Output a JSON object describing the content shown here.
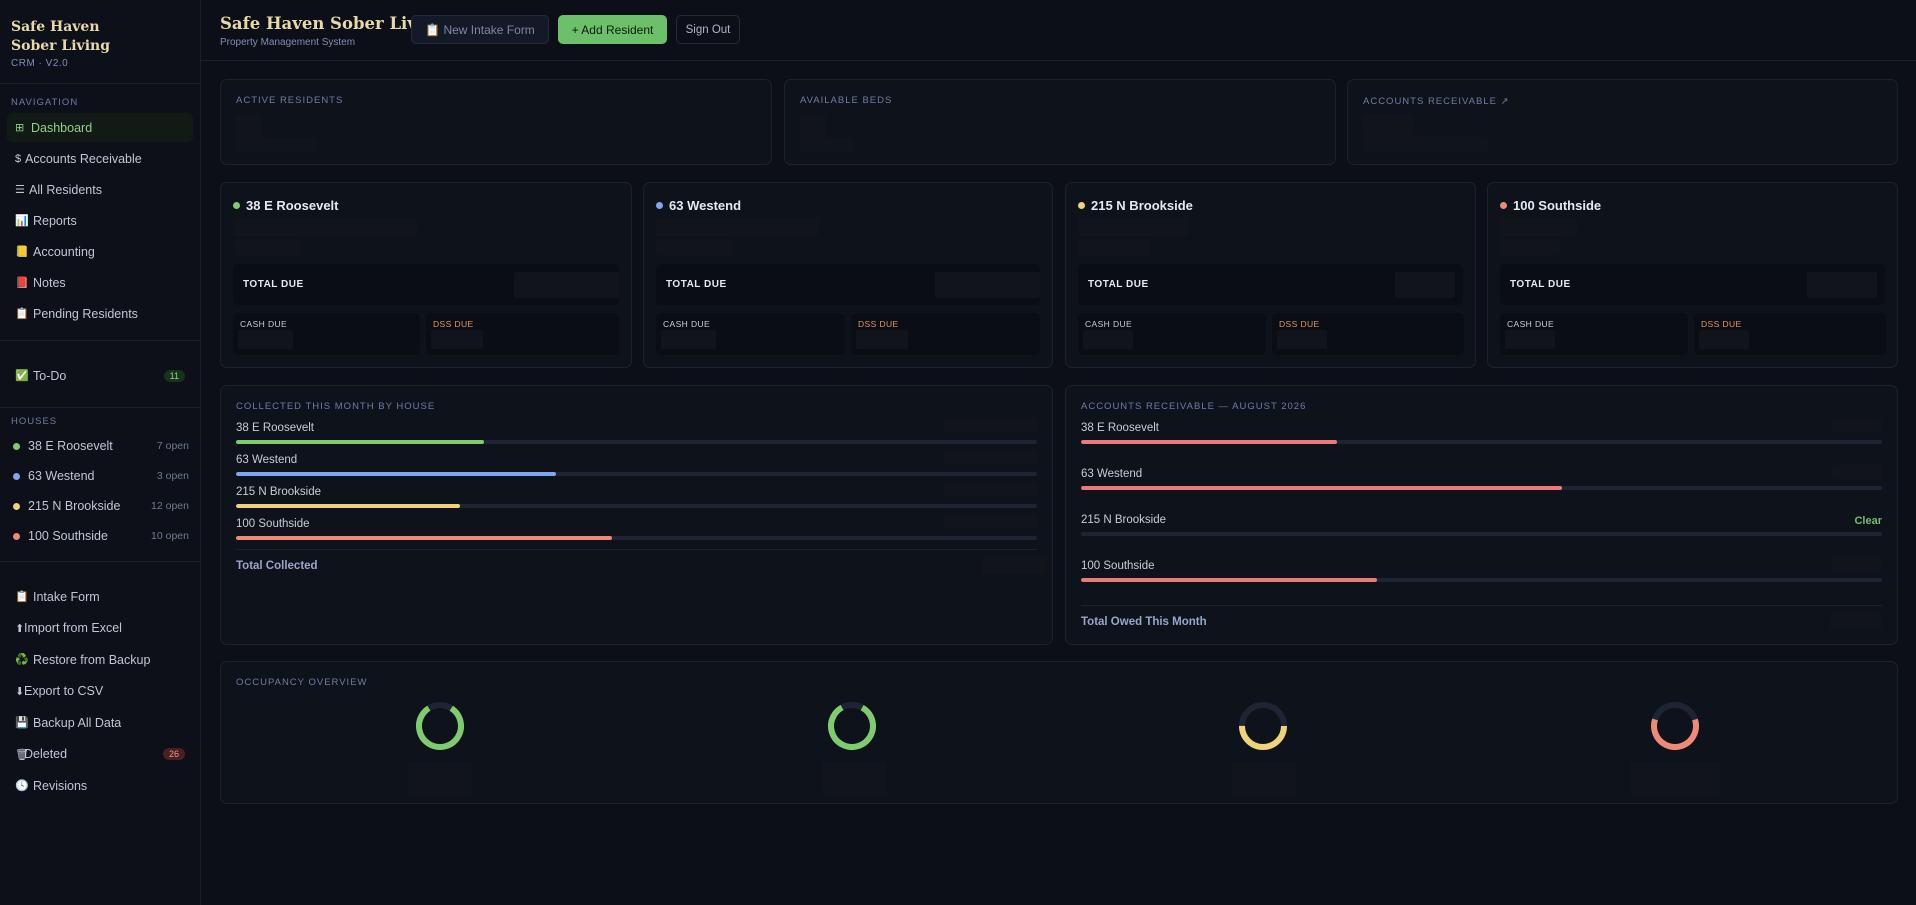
{
  "colors": {
    "green": "#7fcc6f",
    "blue": "#7fa6f0",
    "yellow": "#efd27a",
    "salmon": "#ee8a76",
    "red": "#ec7a7a",
    "accent": "#6cc069"
  },
  "brand": {
    "line1": "Safe Haven",
    "line2": "Sober Living",
    "version": "CRM · V2.0"
  },
  "sidebar": {
    "nav_label": "NAVIGATION",
    "nav": [
      {
        "icon": "⊞",
        "label": "Dashboard"
      },
      {
        "icon": "$",
        "label": "Accounts Receivable"
      },
      {
        "icon": "☰",
        "label": "All Residents"
      },
      {
        "icon": "📊",
        "label": "Reports"
      },
      {
        "icon": "📒",
        "label": "Accounting"
      },
      {
        "icon": "📕",
        "label": "Notes"
      },
      {
        "icon": "📋",
        "label": "Pending Residents"
      }
    ],
    "todo": {
      "icon": "✅",
      "label": "To-Do",
      "count": "11"
    },
    "houses_label": "HOUSES",
    "houses": [
      {
        "name": "38 E Roosevelt",
        "open": "7 open",
        "color": "#7fcc6f"
      },
      {
        "name": "63 Westend",
        "open": "3 open",
        "color": "#7fa6f0"
      },
      {
        "name": "215 N Brookside",
        "open": "12 open",
        "color": "#efd27a"
      },
      {
        "name": "100 Southside",
        "open": "10 open",
        "color": "#ee8a76"
      }
    ],
    "tools": [
      {
        "icon": "📋",
        "label": "Intake Form"
      },
      {
        "icon": "⬆",
        "label": "Import from Excel"
      },
      {
        "icon": "♻️",
        "label": "Restore from Backup"
      },
      {
        "icon": "⬇",
        "label": "Export to CSV"
      },
      {
        "icon": "💾",
        "label": "Backup All Data"
      },
      {
        "icon": "🗑",
        "label": "Deleted",
        "count": "26"
      },
      {
        "icon": "🕓",
        "label": "Revisions"
      }
    ]
  },
  "header": {
    "title": "Safe Haven Sober Living",
    "subtitle": "Property Management System",
    "intake_btn": "📋  New Intake Form",
    "add_btn": "+ Add Resident",
    "signout_btn": "Sign Out"
  },
  "stats": {
    "active_residents": "ACTIVE RESIDENTS",
    "available_beds": "AVAILABLE BEDS",
    "accounts_receivable": "ACCOUNTS RECEIVABLE ↗"
  },
  "house_cards": {
    "total_due": "TOTAL DUE",
    "cash_due": "CASH DUE",
    "dss_due": "DSS DUE",
    "houses": [
      "38 E Roosevelt",
      "63 Westend",
      "215 N Brookside",
      "100 Southside"
    ]
  },
  "collected": {
    "title": "COLLECTED THIS MONTH BY HOUSE",
    "rows": [
      {
        "name": "38 E Roosevelt",
        "fraction": 0.31
      },
      {
        "name": "63 Westend",
        "fraction": 0.4
      },
      {
        "name": "215 N Brookside",
        "fraction": 0.28
      },
      {
        "name": "100 Southside",
        "fraction": 0.47
      }
    ],
    "total_label": "Total Collected"
  },
  "receivable": {
    "title": "ACCOUNTS RECEIVABLE — AUGUST 2026",
    "rows": [
      {
        "name": "38 E Roosevelt",
        "fraction": 0.32
      },
      {
        "name": "63 Westend",
        "fraction": 0.6
      },
      {
        "name": "215 N Brookside",
        "fraction": 0,
        "status": "Clear"
      },
      {
        "name": "100 Southside",
        "fraction": 0.37
      }
    ],
    "total_label": "Total Owed This Month"
  },
  "occupancy": {
    "title": "OCCUPANCY OVERVIEW",
    "rings": [
      {
        "color": "#7fcc6f",
        "fraction": 0.82
      },
      {
        "color": "#7fcc6f",
        "fraction": 0.84
      },
      {
        "color": "#efd27a",
        "fraction": 0.5
      },
      {
        "color": "#ee8a76",
        "fraction": 0.6
      }
    ]
  }
}
